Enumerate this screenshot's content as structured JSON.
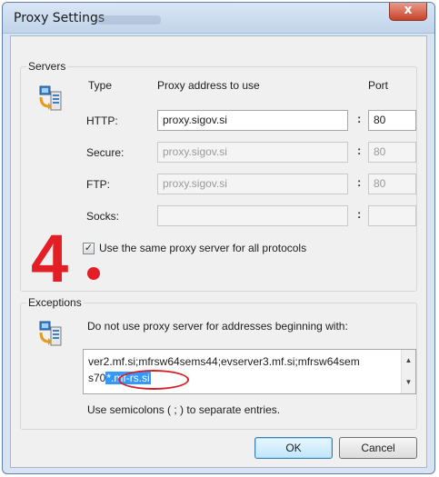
{
  "window": {
    "title": "Proxy Settings",
    "close_label": "x"
  },
  "servers": {
    "group_label": "Servers",
    "col_type": "Type",
    "col_address": "Proxy address to use",
    "col_port": "Port",
    "rows": [
      {
        "type": "HTTP:",
        "address": "proxy.sigov.si",
        "port": "80",
        "enabled": true
      },
      {
        "type": "Secure:",
        "address": "proxy.sigov.si",
        "port": "80",
        "enabled": false
      },
      {
        "type": "FTP:",
        "address": "proxy.sigov.si",
        "port": "80",
        "enabled": false
      },
      {
        "type": "Socks:",
        "address": "",
        "port": "",
        "enabled": false
      }
    ],
    "colon": ":",
    "same_proxy_label": "Use the same proxy server for all protocols",
    "same_proxy_checked": true
  },
  "annotation": {
    "step_number": "4"
  },
  "exceptions": {
    "group_label": "Exceptions",
    "description": "Do not use proxy server for addresses beginning with:",
    "value_line1": "ver2.mf.si;mfrsw64sems44;evserver3.mf.si;mfrsw64sem",
    "value_line2_prefix": "s70",
    "value_line2_highlight": "*.mf-rs.si",
    "hint": "Use semicolons ( ; ) to separate entries."
  },
  "buttons": {
    "ok": "OK",
    "cancel": "Cancel"
  },
  "colors": {
    "accent_red": "#e31e24",
    "selection": "#3399ff",
    "title_bar": "#c1d4ea",
    "close_button": "#c7432a"
  },
  "icons": {
    "servers_icon": "network-computers-icon",
    "exceptions_icon": "network-computers-icon",
    "checkbox": "check-icon"
  }
}
